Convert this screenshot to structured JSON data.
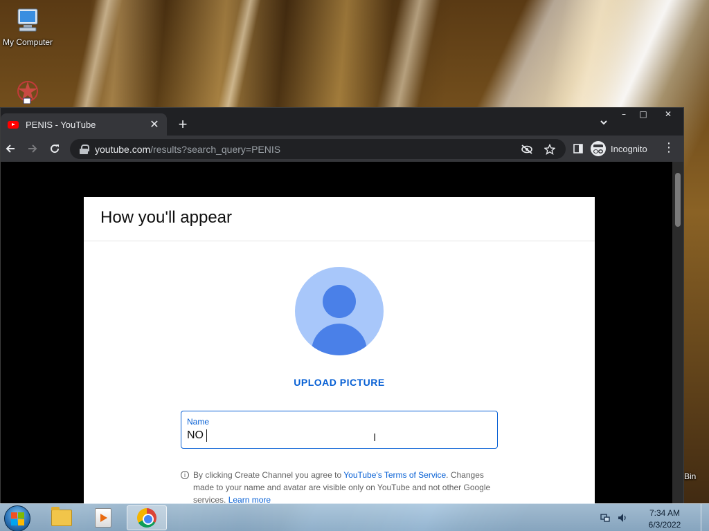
{
  "desktop": {
    "icons": [
      {
        "label": "My Computer"
      },
      {
        "label": ""
      },
      {
        "label": "Bin"
      }
    ]
  },
  "browser": {
    "window_controls": {
      "minimize": "–",
      "maximize": "□",
      "close": "✕"
    },
    "tab": {
      "title": "PENIS - YouTube",
      "close": "✕"
    },
    "new_tab": "+",
    "tab_search": "⌄",
    "url_host": "youtube.com",
    "url_rest": "/results?search_query=PENIS",
    "profile_label": "Incognito",
    "menu": "⋮"
  },
  "dialog": {
    "title": "How you'll appear",
    "upload_label": "UPLOAD PICTURE",
    "name_label": "Name",
    "name_value": "NO",
    "info_text_1": "By clicking Create Channel you agree to ",
    "terms_link": "YouTube's Terms of Service",
    "info_text_2": ". Changes made to your name and avatar are visible only on YouTube and not other Google services. ",
    "learn_more": "Learn more"
  },
  "taskbar": {
    "time": "7:34 AM",
    "date": "6/3/2022"
  },
  "colors": {
    "youtube_blue": "#065fd4",
    "browser_dark": "#202124",
    "toolbar": "#35363a",
    "avatar_bg": "#a8c7fa",
    "avatar_fg": "#4a80e8"
  }
}
